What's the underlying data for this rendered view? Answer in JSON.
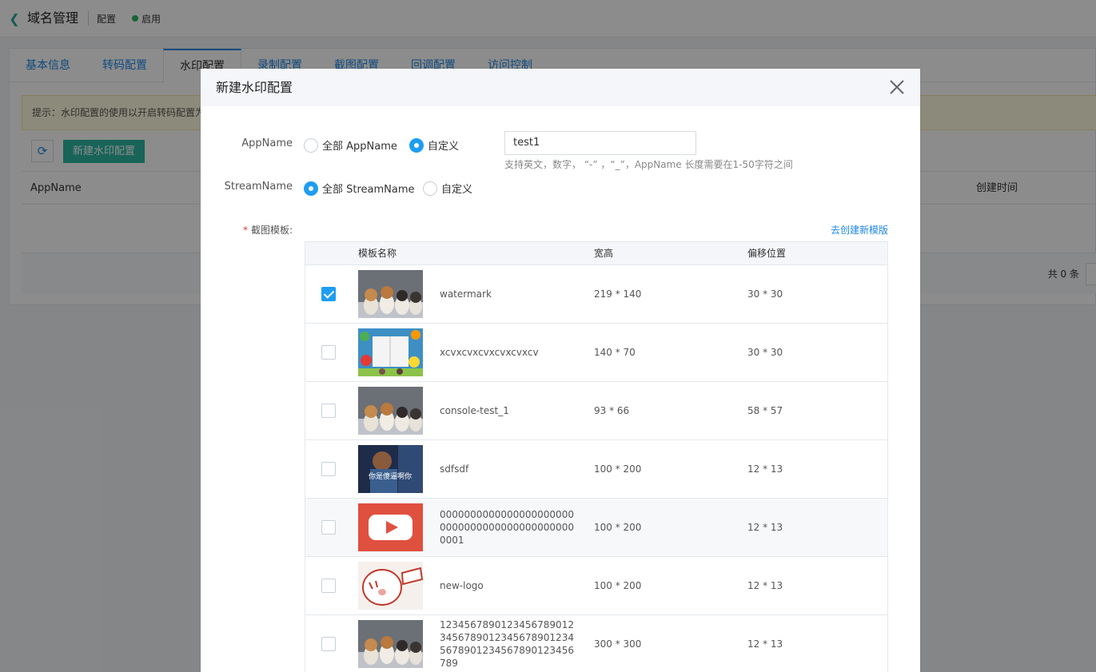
{
  "header": {
    "title": "域名管理",
    "crumb": "配置",
    "status": "启用"
  },
  "tabs": [
    "基本信息",
    "转码配置",
    "水印配置",
    "录制配置",
    "截图配置",
    "回调配置",
    "访问控制"
  ],
  "tip": "提示：水印配置的使用以开启转码配置为",
  "toolbar": {
    "new_label": "新建水印配置"
  },
  "bg_table": {
    "col_app": "AppName",
    "col_time": "创建时间",
    "total": "共 0 条"
  },
  "modal": {
    "title": "新建水印配置",
    "appname_label": "AppName",
    "appname_all": "全部 AppName",
    "appname_custom": "自定义",
    "appname_value": "test1",
    "appname_hint": "支持英文，数字， “-” ，“_”，AppName 长度需要在1-50字符之间",
    "streamname_label": "StreamName",
    "streamname_all": "全部 StreamName",
    "streamname_custom": "自定义",
    "template_label": "截图模板:",
    "create_link": "去创建新模版",
    "columns": {
      "name": "模板名称",
      "size": "宽高",
      "offset": "偏移位置"
    },
    "rows": [
      {
        "checked": true,
        "thumb": "puppies",
        "name": "watermark",
        "size": "219 * 140",
        "offset": "30 * 30"
      },
      {
        "checked": false,
        "thumb": "flowers",
        "name": "xcvxcvxcvxcvxcvxcv",
        "size": "140 * 70",
        "offset": "30 * 30"
      },
      {
        "checked": false,
        "thumb": "puppies",
        "name": "console-test_1",
        "size": "93 * 66",
        "offset": "58 * 57"
      },
      {
        "checked": false,
        "thumb": "person",
        "name": "sdfsdf",
        "size": "100 * 200",
        "offset": "12 * 13"
      },
      {
        "checked": false,
        "thumb": "youtube",
        "name": "000000000000000000000000000000000000000000000001",
        "size": "100 * 200",
        "offset": "12 * 13"
      },
      {
        "checked": false,
        "thumb": "cartoon",
        "name": "new-logo",
        "size": "100 * 200",
        "offset": "12 * 13"
      },
      {
        "checked": false,
        "thumb": "puppies",
        "name": "123456789012345678901234567890123456789012345678901234567890123456789",
        "size": "300 * 300",
        "offset": "12 * 13"
      }
    ],
    "thumb_caption_person": "你是傻逼啊你"
  }
}
